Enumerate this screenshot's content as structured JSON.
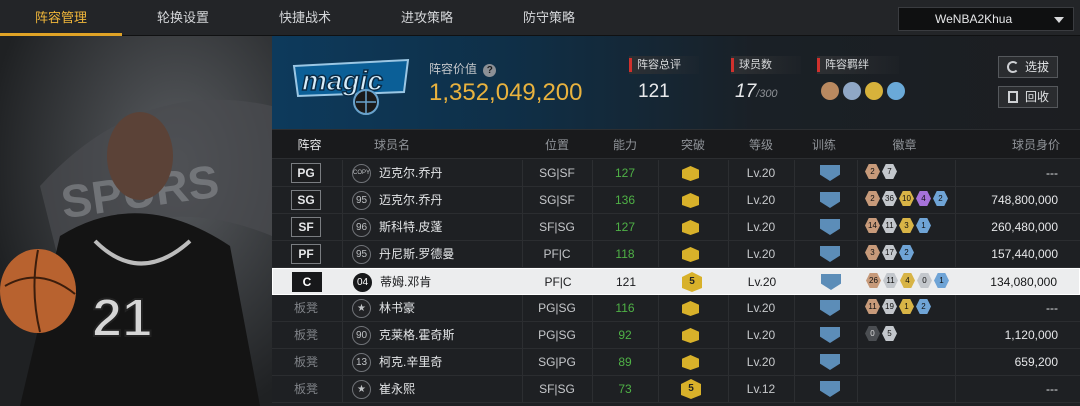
{
  "nav": {
    "tabs": [
      "阵容管理",
      "轮换设置",
      "快捷战术",
      "进攻策略",
      "防守策略"
    ],
    "active": 0,
    "account": "WeNBA2Khua"
  },
  "header": {
    "value_label": "阵容价值",
    "value": "1,352,049,200",
    "overall_label": "阵容总评",
    "overall": "121",
    "count_label": "球员数",
    "count": "17",
    "count_max": "/300",
    "synergy_label": "阵容羁绊",
    "pick_button": "选拔",
    "recycle_button": "回收"
  },
  "colors": {
    "accent": "#e0a326",
    "green": "#4fb146",
    "red": "#d0312d",
    "magic_blue": "#0d6aa8"
  },
  "table": {
    "columns": [
      "阵容",
      "球员名",
      "位置",
      "能力",
      "突破",
      "等级",
      "训练",
      "徽章",
      "球员身价"
    ],
    "rows": [
      {
        "slot": "PG",
        "num": "COPY",
        "name": "迈克尔.乔丹",
        "pos": "SG|SF",
        "ability": "127",
        "green": true,
        "level": "Lv.20",
        "value": "---",
        "badges": [
          [
            "b-br",
            "2"
          ],
          [
            "b-si",
            "7"
          ]
        ]
      },
      {
        "slot": "SG",
        "num": "95",
        "name": "迈克尔.乔丹",
        "pos": "SG|SF",
        "ability": "136",
        "green": true,
        "level": "Lv.20",
        "value": "748,800,000",
        "badges": [
          [
            "b-br",
            "2"
          ],
          [
            "b-si",
            "36"
          ],
          [
            "b-go",
            "10"
          ],
          [
            "b-pu",
            "4"
          ],
          [
            "b-bl",
            "2"
          ]
        ]
      },
      {
        "slot": "SF",
        "num": "96",
        "name": "斯科特.皮蓬",
        "pos": "SF|SG",
        "ability": "127",
        "green": true,
        "level": "Lv.20",
        "value": "260,480,000",
        "badges": [
          [
            "b-br",
            "14"
          ],
          [
            "b-si",
            "11"
          ],
          [
            "b-go",
            "3"
          ],
          [
            "b-bl",
            "1"
          ]
        ]
      },
      {
        "slot": "PF",
        "num": "95",
        "name": "丹尼斯.罗德曼",
        "pos": "PF|C",
        "ability": "118",
        "green": true,
        "level": "Lv.20",
        "value": "157,440,000",
        "badges": [
          [
            "b-br",
            "3"
          ],
          [
            "b-si",
            "17"
          ],
          [
            "b-bl",
            "2"
          ]
        ]
      },
      {
        "slot": "C",
        "num": "04",
        "name": "蒂姆.邓肯",
        "pos": "PF|C",
        "ability": "121",
        "green": false,
        "level": "Lv.20",
        "value": "134,080,000",
        "selected": true,
        "crownnum": "5",
        "badges": [
          [
            "b-br",
            "26"
          ],
          [
            "b-si",
            "11"
          ],
          [
            "b-go",
            "4"
          ],
          [
            "b-si",
            "0"
          ],
          [
            "b-bl",
            "1"
          ]
        ]
      },
      {
        "slot": "板凳",
        "num": "★",
        "name": "林书豪",
        "pos": "PG|SG",
        "ability": "116",
        "green": true,
        "level": "Lv.20",
        "value": "---",
        "bench": true,
        "badges": [
          [
            "b-br",
            "11"
          ],
          [
            "b-si",
            "19"
          ],
          [
            "b-go",
            "1"
          ],
          [
            "b-bl",
            "2"
          ]
        ]
      },
      {
        "slot": "板凳",
        "num": "90",
        "name": "克莱格.霍奇斯",
        "pos": "PG|SG",
        "ability": "92",
        "green": true,
        "level": "Lv.20",
        "value": "1,120,000",
        "bench": true,
        "badges": [
          [
            "b-dk",
            "0"
          ],
          [
            "b-si",
            "5"
          ]
        ]
      },
      {
        "slot": "板凳",
        "num": "13",
        "name": "柯克.辛里奇",
        "pos": "SG|PG",
        "ability": "89",
        "green": true,
        "level": "Lv.20",
        "value": "659,200",
        "bench": true,
        "badges": []
      },
      {
        "slot": "板凳",
        "num": "★",
        "name": "崔永熙",
        "pos": "SF|SG",
        "ability": "73",
        "green": true,
        "level": "Lv.12",
        "value": "---",
        "bench": true,
        "crownnum": "5",
        "badges": []
      }
    ]
  }
}
